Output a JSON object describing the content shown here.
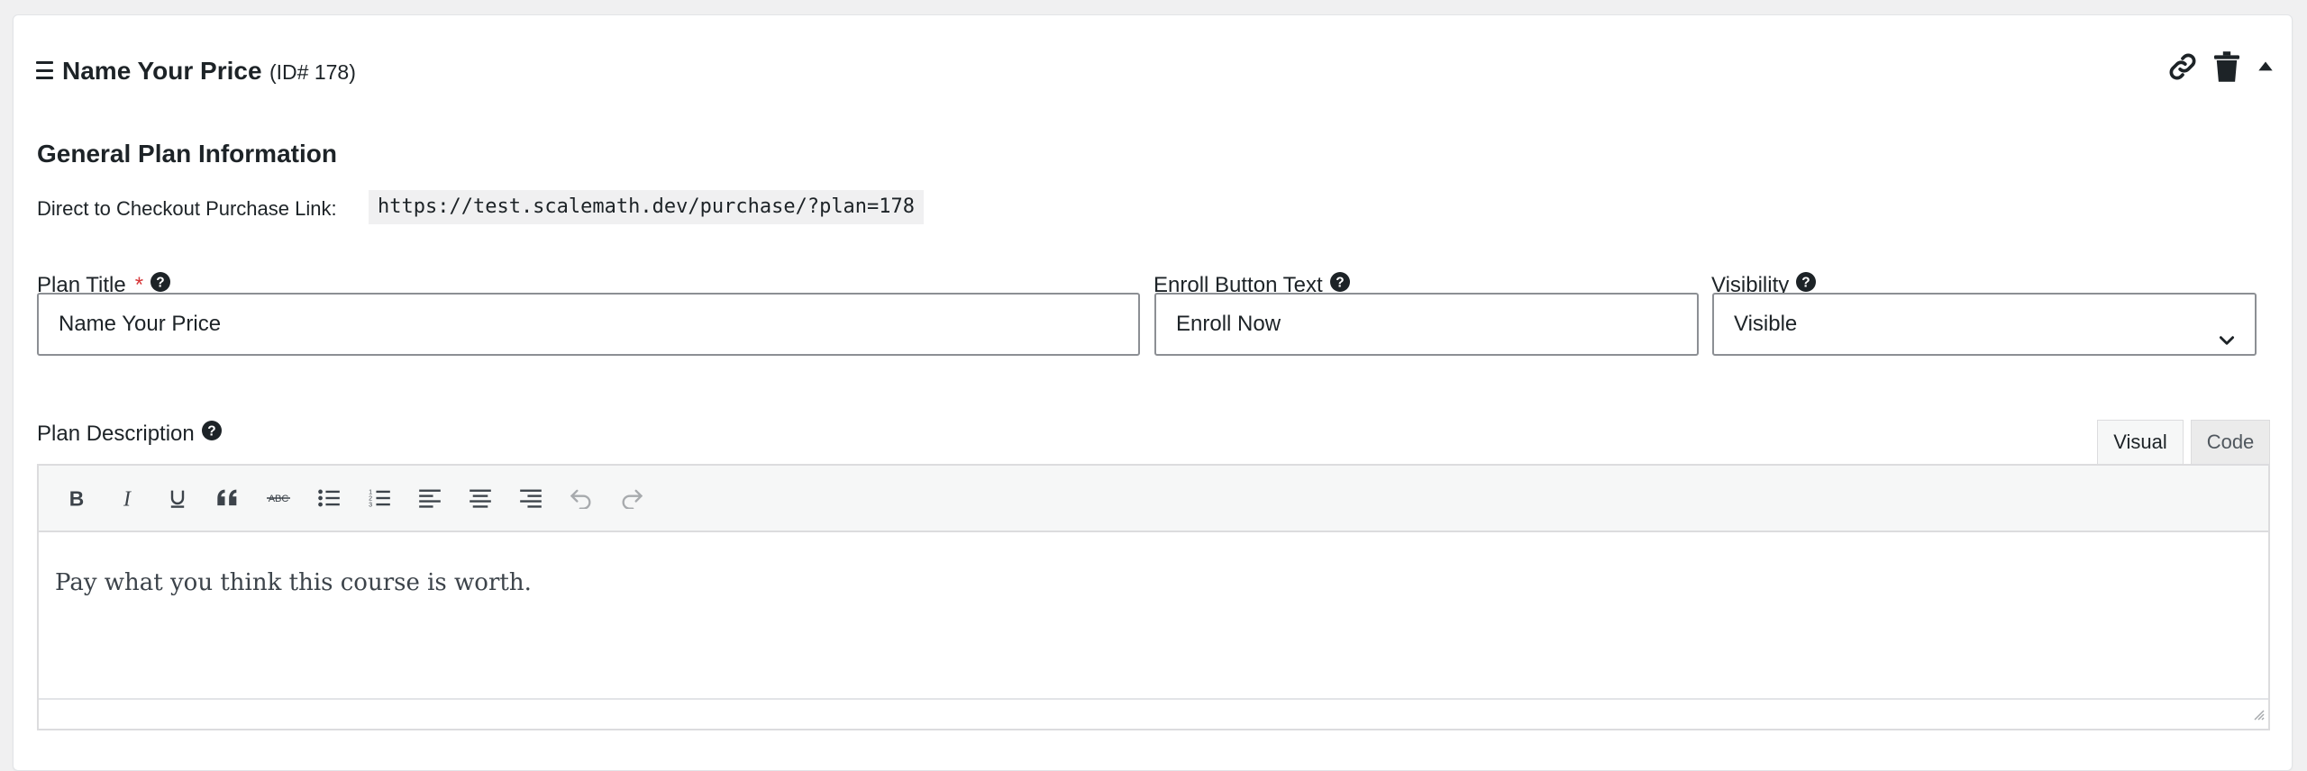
{
  "header": {
    "title": "Name Your Price",
    "id_text": "(ID# 178)",
    "icons": [
      "hamburger-icon",
      "link-icon",
      "trash-icon",
      "caret-up-icon"
    ]
  },
  "general": {
    "section_title": "General Plan Information",
    "link_label": "Direct to Checkout Purchase Link:",
    "link_url": "https://test.scalemath.dev/purchase/?plan=178"
  },
  "fields": {
    "plan_title": {
      "label": "Plan Title",
      "required_mark": "*",
      "value": "Name Your Price"
    },
    "enroll_button": {
      "label": "Enroll Button Text",
      "value": "Enroll Now"
    },
    "visibility": {
      "label": "Visibility",
      "value": "Visible"
    }
  },
  "description": {
    "label": "Plan Description",
    "tabs": {
      "visual": "Visual",
      "code": "Code"
    },
    "content": "Pay what you think this course is worth.",
    "toolbar": [
      "bold",
      "italic",
      "underline",
      "blockquote",
      "strikethrough",
      "bullet-list",
      "numbered-list",
      "align-left",
      "align-center",
      "align-right",
      "undo",
      "redo"
    ]
  },
  "colors": {
    "required": "#d63638",
    "border": "#8c8f94",
    "text": "#1d2327"
  }
}
